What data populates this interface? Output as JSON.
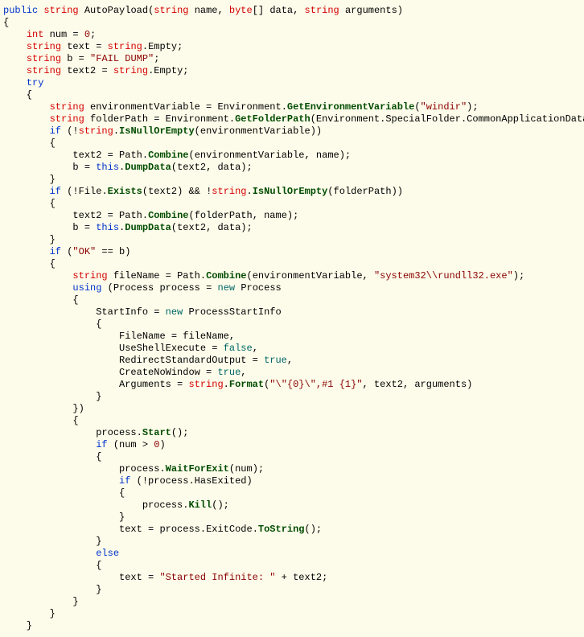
{
  "t": {
    "k_public": "public",
    "k_string": "string",
    "k_byte": "byte",
    "k_int": "int",
    "k_try": "try",
    "k_if": "if",
    "k_else": "else",
    "k_using": "using",
    "k_this": "this",
    "k_new": "new",
    "k_false": "false",
    "k_true": "true",
    "m_AutoPayload": "AutoPayload",
    "m_GetEnvVar": "GetEnvironmentVariable",
    "m_GetFolderPath": "GetFolderPath",
    "m_IsNullOrEmpty": "IsNullOrEmpty",
    "m_Combine": "Combine",
    "m_DumpData": "DumpData",
    "m_Exists": "Exists",
    "m_Format": "Format",
    "m_Start": "Start",
    "m_WaitForExit": "WaitForExit",
    "m_Kill": "Kill",
    "m_ToString": "ToString",
    "s_windir": "\"windir\"",
    "s_faildump": "\"FAIL DUMP\"",
    "s_ok": "\"OK\"",
    "s_rundll": "\"system32\\\\rundll32.exe\"",
    "s_fmt": "\"\\\"{0}\\\",#1 {1}\"",
    "s_started": "\"Started Infinite: \"",
    "n_zero": "0",
    "p_name": "name",
    "p_data": "data",
    "p_arguments": "arguments",
    "v_num": "num",
    "v_text": "text",
    "v_b": "b",
    "v_text2": "text2",
    "v_envVar": "environmentVariable",
    "v_folderPath": "folderPath",
    "v_fileName": "fileName",
    "v_process": "process",
    "c_Environment": "Environment",
    "c_SpecialFolder": "SpecialFolder",
    "c_CommonAppData": "CommonApplicationData",
    "c_Path": "Path",
    "c_File": "File",
    "c_Process": "Process",
    "c_ProcessStartInfo": "ProcessStartInfo",
    "c_Empty": "Empty",
    "c_StartInfo": "StartInfo",
    "c_FileName": "FileName",
    "c_UseShellExecute": "UseShellExecute",
    "c_RedirectStdOut": "RedirectStandardOutput",
    "c_CreateNoWindow": "CreateNoWindow",
    "c_Arguments": "Arguments",
    "c_HasExited": "HasExited",
    "c_ExitCode": "ExitCode"
  }
}
